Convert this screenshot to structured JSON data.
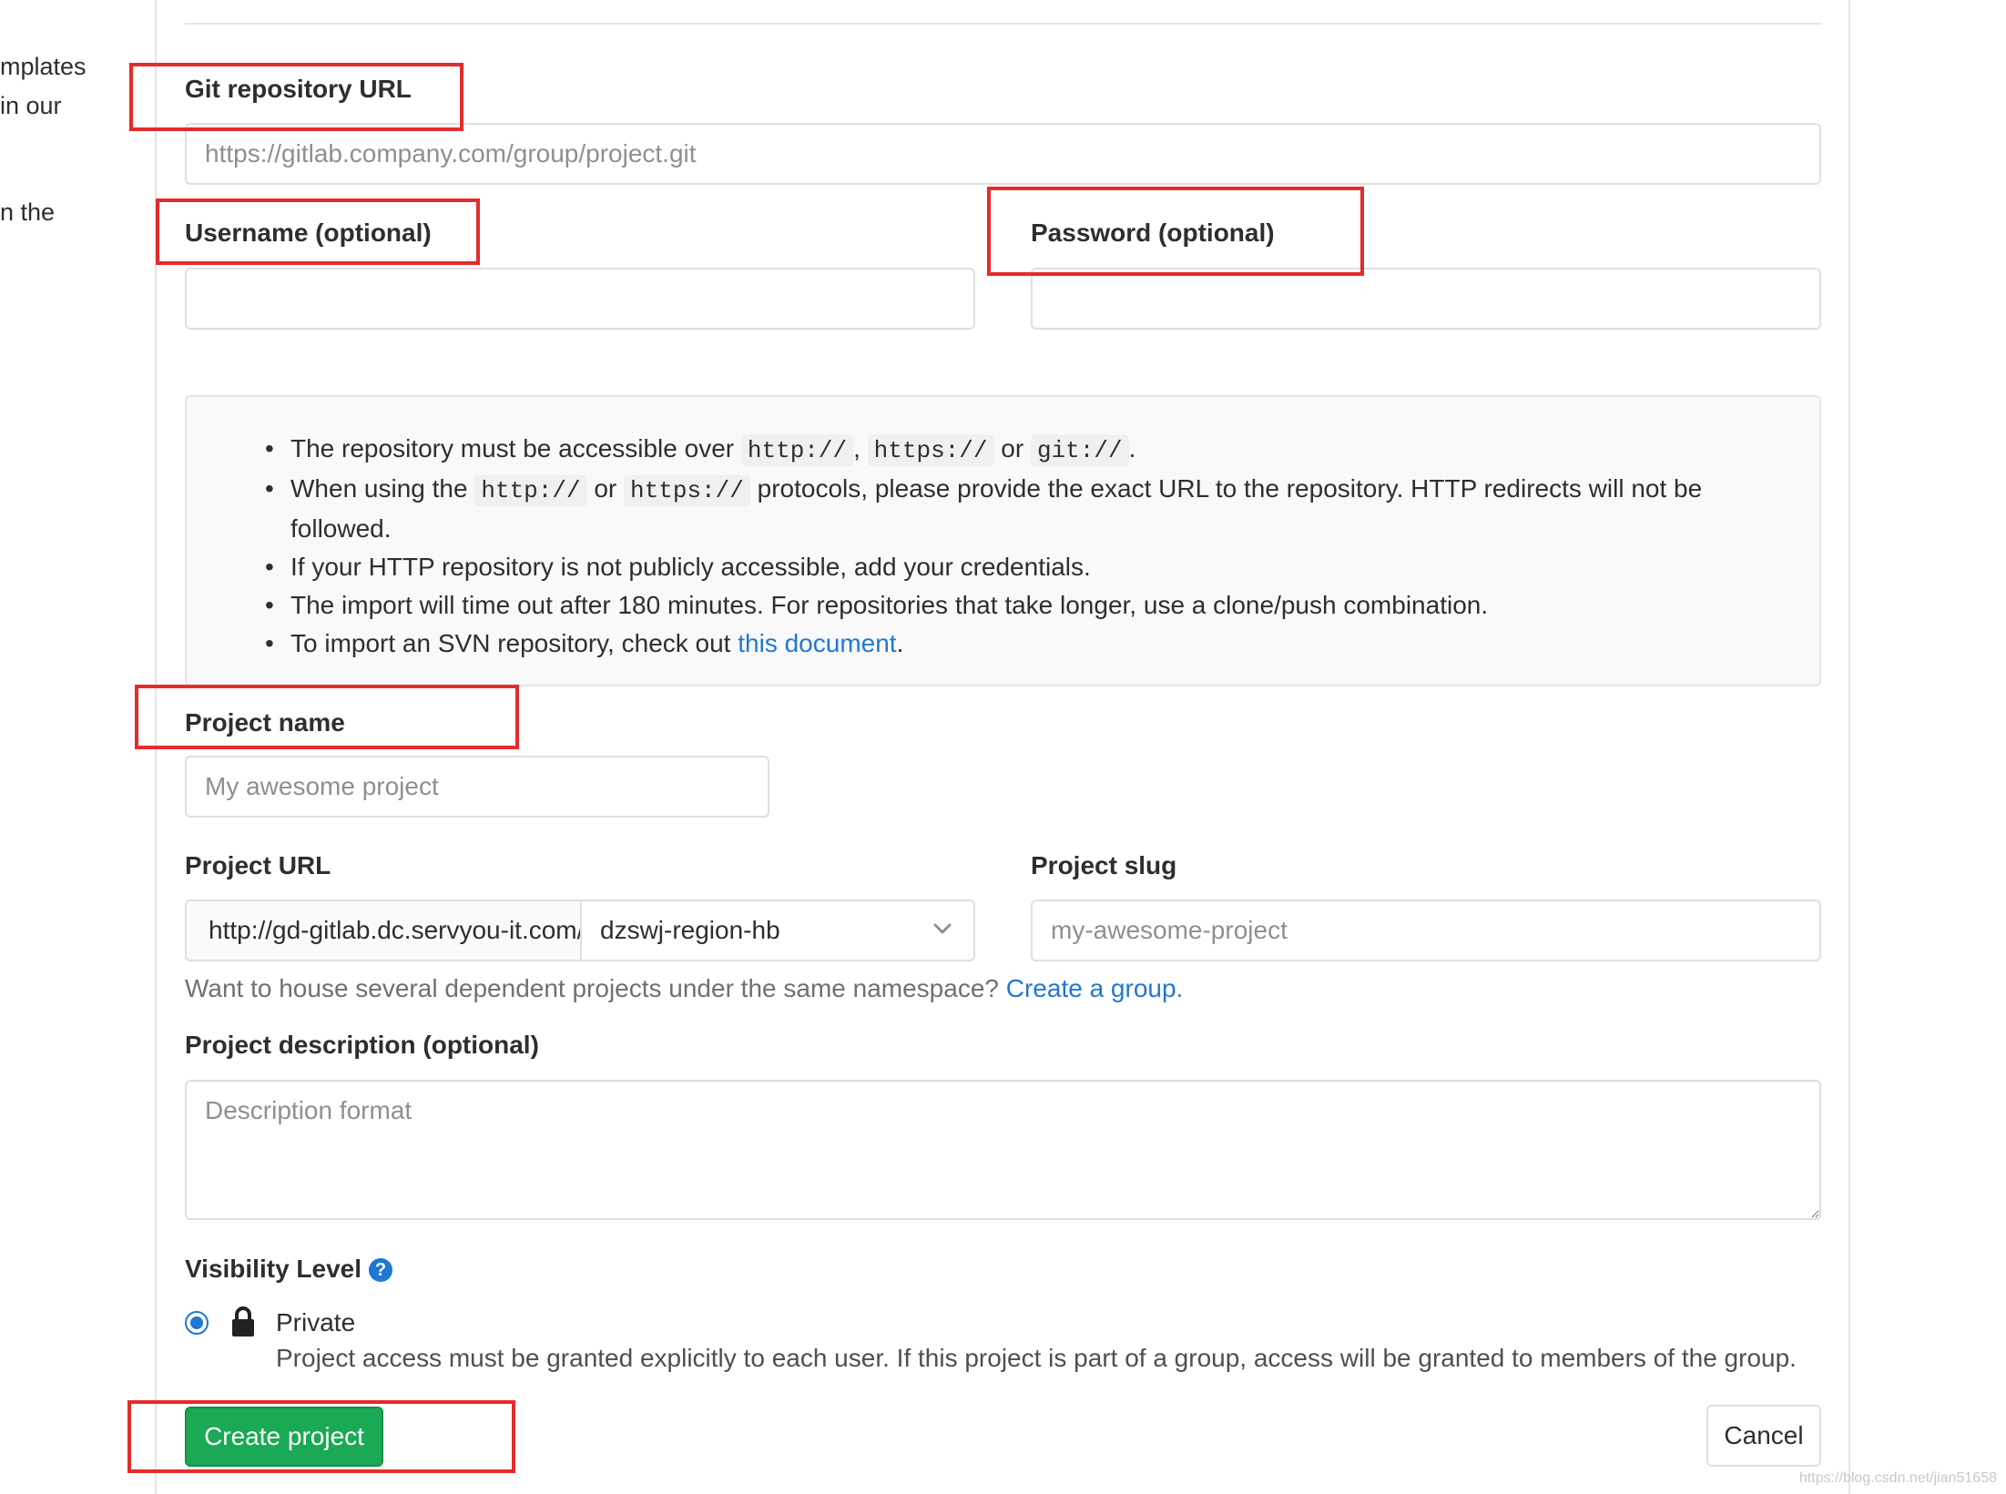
{
  "sidebar_fragment": {
    "line1": "mplates",
    "line2": "in our",
    "line3": "n the"
  },
  "git_repo": {
    "label": "Git repository URL",
    "placeholder": "https://gitlab.company.com/group/project.git",
    "value": ""
  },
  "username": {
    "label": "Username (optional)",
    "value": ""
  },
  "password": {
    "label": "Password (optional)",
    "value": ""
  },
  "info": {
    "item1_text_a": "The repository must be accessible over",
    "item1_code1": "http://",
    "item1_sep": ",",
    "item1_code2": "https://",
    "item1_or": "or",
    "item1_code3": "git://",
    "item1_end": ".",
    "item2_text_a": "When using the",
    "item2_code1": "http://",
    "item2_or": "or",
    "item2_code2": "https://",
    "item2_text_b": "protocols, please provide the exact URL to the repository. HTTP redirects will not be followed.",
    "item3": "If your HTTP repository is not publicly accessible, add your credentials.",
    "item4": "The import will time out after 180 minutes. For repositories that take longer, use a clone/push combination.",
    "item5_text": "To import an SVN repository, check out",
    "item5_link": "this document",
    "item5_end": "."
  },
  "project_name": {
    "label": "Project name",
    "placeholder": "My awesome project",
    "value": ""
  },
  "project_url": {
    "label": "Project URL",
    "prefix": "http://gd-gitlab.dc.servyou-it.com/",
    "namespace": "dzswj-region-hb"
  },
  "project_slug": {
    "label": "Project slug",
    "placeholder": "my-awesome-project",
    "value": ""
  },
  "namespace_hint": {
    "text": "Want to house several dependent projects under the same namespace?",
    "link": "Create a group",
    "end": "."
  },
  "description": {
    "label": "Project description (optional)",
    "placeholder": "Description format",
    "value": ""
  },
  "visibility": {
    "label": "Visibility Level",
    "help_icon": "question-circle-icon",
    "option_label": "Private",
    "option_icon": "lock-icon",
    "option_desc": "Project access must be granted explicitly to each user. If this project is part of a group, access will be granted to members of the group."
  },
  "actions": {
    "create_label": "Create project",
    "cancel_label": "Cancel"
  },
  "watermark": "https://blog.csdn.net/jian51658",
  "colors": {
    "highlight": "#e52b2b",
    "primary_green": "#1aaa55",
    "link_blue": "#1f78d1"
  }
}
